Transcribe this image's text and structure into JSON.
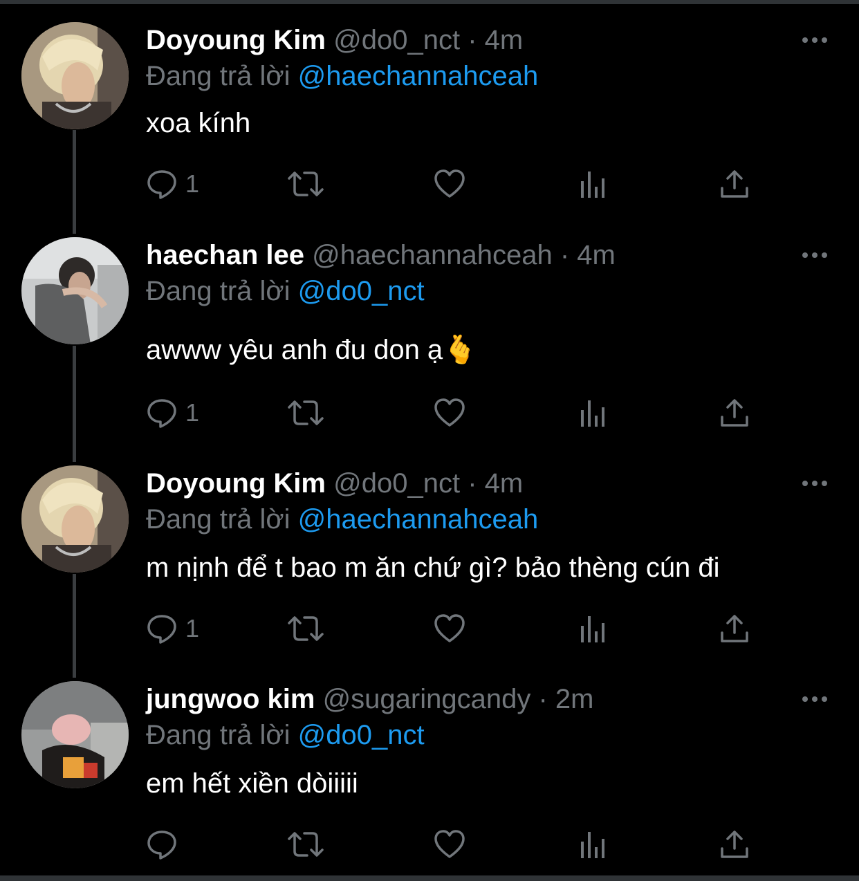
{
  "colors": {
    "background": "#000000",
    "name": "#ffffff",
    "secondary": "#71767b",
    "mention": "#1d9bf0",
    "thread_line": "#3a3d40"
  },
  "tweets": [
    {
      "name": "Doyoung Kim",
      "handle": "@do0_nct",
      "dot": "·",
      "time": "4m",
      "reply_prefix": "Đang trả lời",
      "reply_to": "@haechannahceah",
      "text": "xoa kính",
      "reply_count": "1"
    },
    {
      "name": "haechan lee",
      "handle": "@haechannahceah",
      "dot": "·",
      "time": "4m",
      "reply_prefix": "Đang trả lời",
      "reply_to": "@do0_nct",
      "text": "awww yêu anh đu don ạ🫰",
      "reply_count": "1"
    },
    {
      "name": "Doyoung Kim",
      "handle": "@do0_nct",
      "dot": "·",
      "time": "4m",
      "reply_prefix": "Đang trả lời",
      "reply_to": "@haechannahceah",
      "text": "m nịnh để t bao m ăn chứ gì? bảo thèng cún đi",
      "reply_count": "1"
    },
    {
      "name": "jungwoo kim",
      "handle": "@sugaringcandy",
      "dot": "·",
      "time": "2m",
      "reply_prefix": "Đang trả lời",
      "reply_to": "@do0_nct",
      "text": "em hết xiền dòiiiii",
      "reply_count": ""
    }
  ],
  "icons": {
    "reply": "speech-bubble-icon",
    "retweet": "retweet-arrows-icon",
    "like": "heart-icon",
    "views": "bar-chart-icon",
    "share": "share-upload-icon",
    "more": "ellipsis-icon"
  }
}
